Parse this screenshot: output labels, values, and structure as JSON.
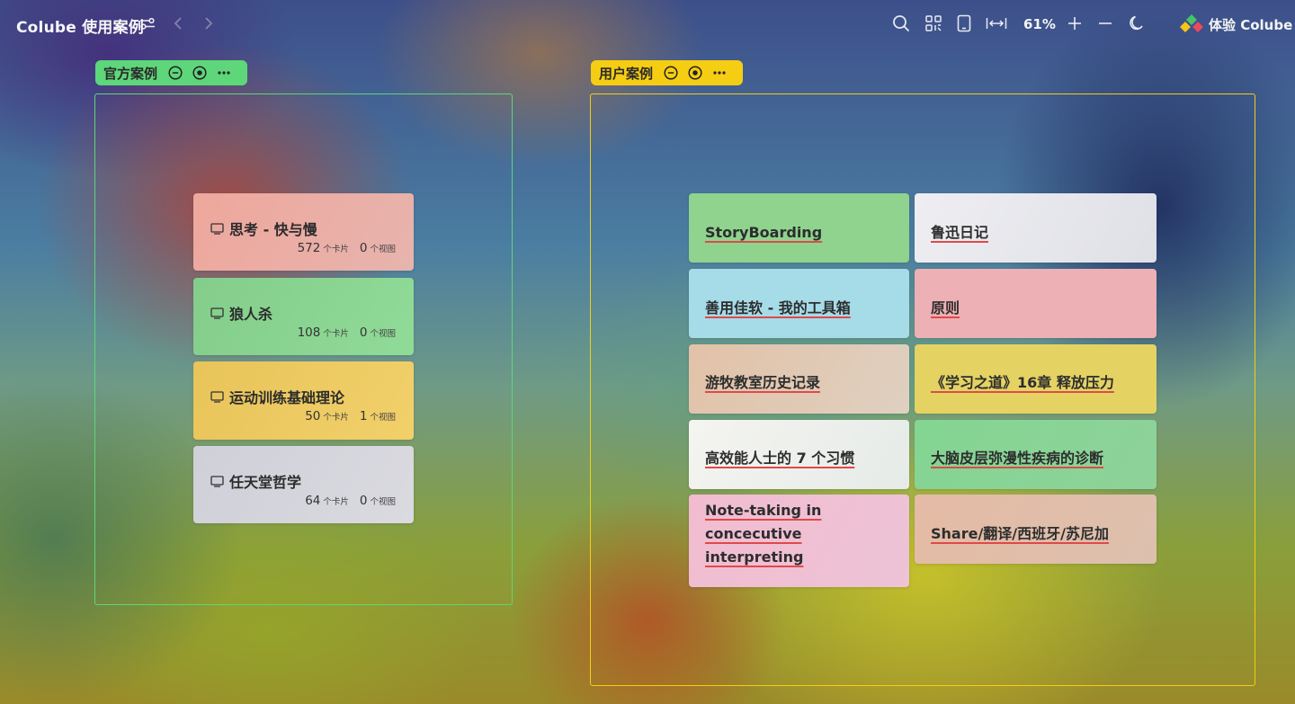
{
  "app": {
    "title": "Colube 使用案例",
    "zoom": "61%",
    "brand_label": "体验 Colube"
  },
  "toolbar_icons": [
    "filter-icon",
    "back-arrow-icon",
    "forward-arrow-icon",
    "search-icon",
    "qr-code-icon",
    "tablet-icon",
    "fit-width-icon",
    "zoom-in-icon",
    "zoom-out-icon",
    "dark-mode-icon"
  ],
  "colors": {
    "official_accent": "#5ed67a",
    "user_accent": "#f5cd13",
    "underline": "#e0494a"
  },
  "groups": {
    "official": {
      "label": "官方案例",
      "cards": [
        {
          "title": "思考 - 快与慢",
          "cards_count": "572",
          "cards_unit": "个卡片",
          "views_count": "0",
          "views_unit": "个视图",
          "color": "#eba79c"
        },
        {
          "title": "狼人杀",
          "cards_count": "108",
          "cards_unit": "个卡片",
          "views_count": "0",
          "views_unit": "个视图",
          "color": "#8bd593"
        },
        {
          "title": "运动训练基础理论",
          "cards_count": "50",
          "cards_unit": "个卡片",
          "views_count": "1",
          "views_unit": "个视图",
          "color": "#eecc62"
        },
        {
          "title": "任天堂哲学",
          "cards_count": "64",
          "cards_unit": "个卡片",
          "views_count": "0",
          "views_unit": "个视图",
          "color": "#d5d5dc"
        }
      ]
    },
    "user": {
      "label": "用户案例",
      "cards": [
        {
          "title": "StoryBoarding",
          "color": "#90d690"
        },
        {
          "title": "鲁迅日记",
          "color": "#e7e8ee"
        },
        {
          "title": "善用佳软 - 我的工具箱",
          "color": "#a6dcea"
        },
        {
          "title": "原则",
          "color": "#eeb0b4"
        },
        {
          "title": "游牧教室历史记录",
          "color": "#e3c6b0"
        },
        {
          "title": "《学习之道》16章 释放压力",
          "color": "#e6d463"
        },
        {
          "title": "高效能人士的 7 个习惯",
          "color": "#eef0ee"
        },
        {
          "title": "大脑皮层弥漫性疾病的诊断",
          "color": "#86d492"
        },
        {
          "title": "Note-taking in concecutive interpreting",
          "color": "#f0bfd2"
        },
        {
          "title": "Share/翻译/西班牙/苏尼加",
          "color": "#e3bda7"
        }
      ]
    }
  }
}
